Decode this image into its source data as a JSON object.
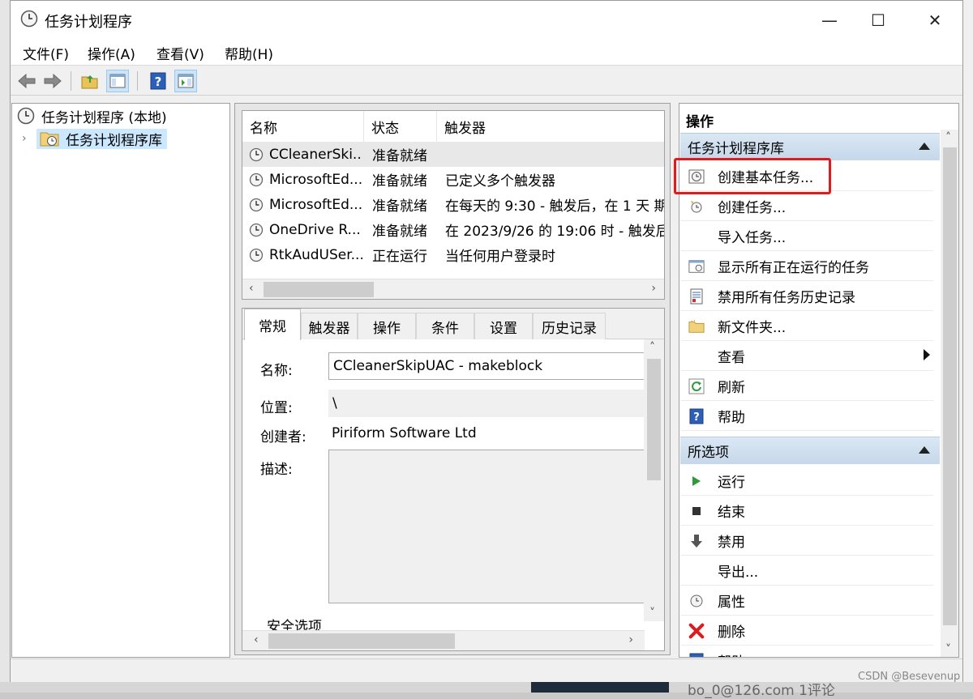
{
  "window": {
    "title": "任务计划程序",
    "controls": {
      "minimize": "—",
      "maximize": "☐",
      "close": "✕"
    }
  },
  "menubar": {
    "items": [
      "文件(F)",
      "操作(A)",
      "查看(V)",
      "帮助(H)"
    ]
  },
  "tree": {
    "root": "任务计划程序 (本地)",
    "child": "任务计划程序库"
  },
  "task_list": {
    "columns": [
      "名称",
      "状态",
      "触发器"
    ],
    "rows": [
      {
        "name": "CCleanerSki...",
        "status": "准备就绪",
        "trigger": ""
      },
      {
        "name": "MicrosoftEd...",
        "status": "准备就绪",
        "trigger": "已定义多个触发器"
      },
      {
        "name": "MicrosoftEd...",
        "status": "准备就绪",
        "trigger": "在每天的 9:30 - 触发后，在 1 天 期"
      },
      {
        "name": "OneDrive R...",
        "status": "准备就绪",
        "trigger": "在 2023/9/26 的 19:06 时 - 触发后"
      },
      {
        "name": "RtkAudUSer...",
        "status": "正在运行",
        "trigger": "当任何用户登录时"
      }
    ]
  },
  "details": {
    "tabs": [
      "常规",
      "触发器",
      "操作",
      "条件",
      "设置",
      "历史记录"
    ],
    "name_label": "名称:",
    "name_value": "CCleanerSkipUAC - makeblock",
    "location_label": "位置:",
    "location_value": "\\",
    "author_label": "创建者:",
    "author_value": "Piriform Software Ltd",
    "description_label": "描述:",
    "security_label": "安全选项"
  },
  "actions_pane": {
    "title": "操作",
    "section1": "任务计划程序库",
    "section1_items": [
      "创建基本任务...",
      "创建任务...",
      "导入任务...",
      "显示所有正在运行的任务",
      "禁用所有任务历史记录",
      "新文件夹...",
      "查看",
      "刷新",
      "帮助"
    ],
    "section2": "所选项",
    "section2_items": [
      "运行",
      "结束",
      "禁用",
      "导出...",
      "属性",
      "删除",
      "帮助"
    ]
  },
  "background": {
    "text": "bo_0@126.com  1评论",
    "watermark": "CSDN @Besevenup"
  }
}
